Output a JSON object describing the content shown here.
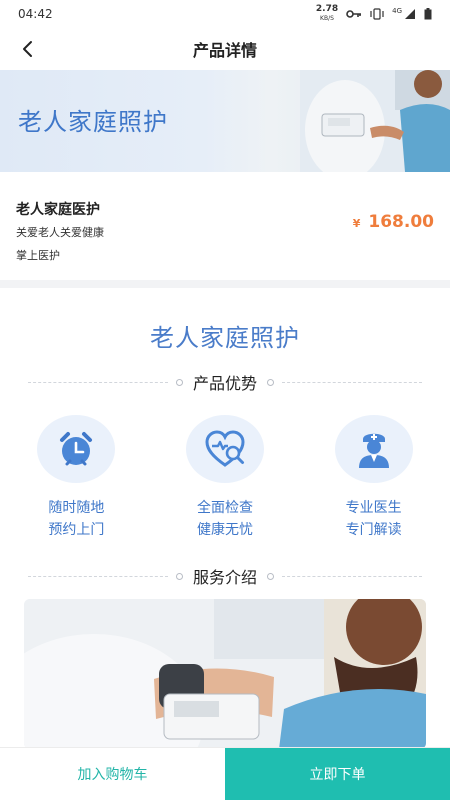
{
  "status_bar": {
    "time": "04:42",
    "speed": "2.78",
    "speed_unit": "KB/S",
    "network": "4G"
  },
  "header": {
    "title": "产品详情"
  },
  "banner": {
    "text": "老人家庭照护"
  },
  "product": {
    "name": "老人家庭医护",
    "line1": "关爱老人关爱健康",
    "line2": "掌上医护",
    "currency": "¥",
    "price": "168.00"
  },
  "detail": {
    "main_title": "老人家庭照护",
    "advantages_title": "产品优势",
    "features": [
      {
        "icon": "alarm-clock-icon",
        "line1": "随时随地",
        "line2": "预约上门"
      },
      {
        "icon": "heart-search-icon",
        "line1": "全面检查",
        "line2": "健康无忧"
      },
      {
        "icon": "doctor-icon",
        "line1": "专业医生",
        "line2": "专门解读"
      }
    ],
    "service_title": "服务介绍"
  },
  "bottom": {
    "cart_label": "加入购物车",
    "order_label": "立即下单"
  },
  "colors": {
    "accent_blue": "#3f77c9",
    "teal": "#1fbeb0",
    "price_orange": "#ef7d3c"
  }
}
